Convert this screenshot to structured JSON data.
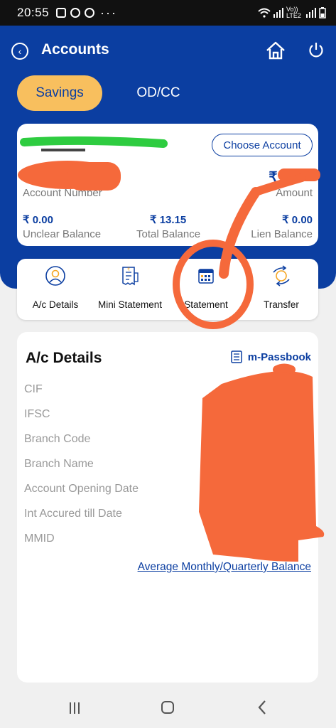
{
  "status_bar": {
    "time": "20:55",
    "network": "Vo)) LTE2"
  },
  "header": {
    "title": "Accounts",
    "back_icon": "back-circle-icon",
    "home_icon": "home-icon",
    "power_icon": "power-icon"
  },
  "tabs": [
    {
      "label": "Savings",
      "active": true
    },
    {
      "label": "OD/CC",
      "active": false
    }
  ],
  "account_card": {
    "choose_account_label": "Choose Account",
    "account_number_label": "Account Number",
    "amount_value": "₹ 1 .15",
    "amount_label": "Amount",
    "balances": [
      {
        "value": "₹ 0.00",
        "label": "Unclear Balance"
      },
      {
        "value": "₹ 13.15",
        "label": "Total Balance"
      },
      {
        "value": "₹ 0.00",
        "label": "Lien Balance"
      }
    ]
  },
  "services": [
    {
      "label": "A/c Details",
      "icon": "user-circle-icon"
    },
    {
      "label": "Mini Statement",
      "icon": "receipt-icon"
    },
    {
      "label": "Statement",
      "icon": "calendar-icon"
    },
    {
      "label": "Transfer",
      "icon": "transfer-icon"
    }
  ],
  "details": {
    "title": "A/c Details",
    "passbook_label": "m-Passbook",
    "rows": [
      "CIF",
      "IFSC",
      "Branch Code",
      "Branch Name",
      "Account Opening Date",
      "Int Accured till Date",
      "MMID"
    ],
    "avg_link": "Average Monthly/Quarterly Balance"
  },
  "colors": {
    "primary": "#0b3ea1",
    "accent": "#f8bf5e",
    "redaction": "#f5693b"
  }
}
